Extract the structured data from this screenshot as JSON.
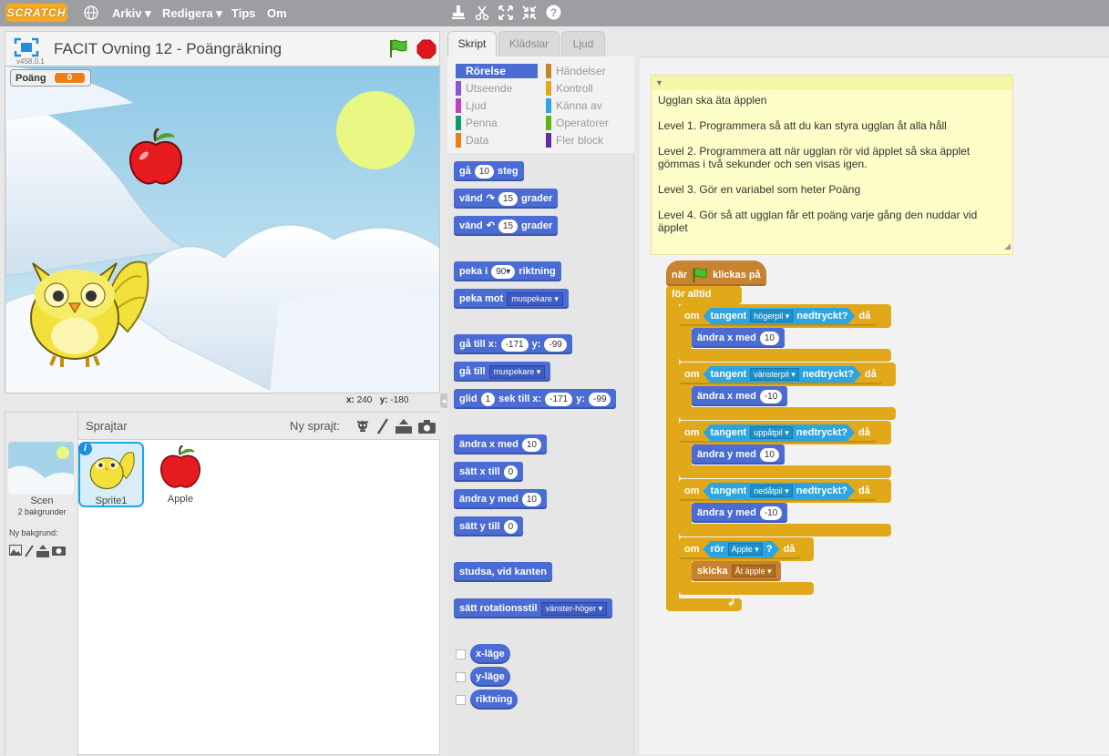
{
  "menubar": {
    "logo": "SCRATCH",
    "items": [
      "Arkiv ▾",
      "Redigera ▾",
      "Tips",
      "Om"
    ]
  },
  "project": {
    "title": "FACIT Ovning 12 - Poängräkning",
    "version": "v458.0.1"
  },
  "monitor": {
    "label": "Poäng",
    "value": "0"
  },
  "coords": {
    "x_label": "x:",
    "x": "240",
    "y_label": "y:",
    "y": "-180"
  },
  "sprites_panel": {
    "title": "Sprajtar",
    "new_sprite": "Ny sprajt:",
    "scene_label": "Scen",
    "scene_sub": "2 bakgrunder",
    "new_backdrop": "Ny bakgrund:",
    "sprites": [
      {
        "name": "Sprite1"
      },
      {
        "name": "Apple"
      }
    ]
  },
  "tabs": [
    "Skript",
    "Klädslar",
    "Ljud"
  ],
  "categories": [
    {
      "label": "Rörelse",
      "color": "#4a6cd4"
    },
    {
      "label": "Händelser",
      "color": "#c88330"
    },
    {
      "label": "Utseende",
      "color": "#8a55d7"
    },
    {
      "label": "Kontroll",
      "color": "#e1a91a"
    },
    {
      "label": "Ljud",
      "color": "#bb42c3"
    },
    {
      "label": "Känna av",
      "color": "#2ca5e2"
    },
    {
      "label": "Penna",
      "color": "#0e9a6c"
    },
    {
      "label": "Operatorer",
      "color": "#5cb712"
    },
    {
      "label": "Data",
      "color": "#ee7d16"
    },
    {
      "label": "Fler block",
      "color": "#632d99"
    }
  ],
  "palette": {
    "move_a": "gå",
    "move_n": "10",
    "move_b": "steg",
    "turn_a": "vänd",
    "turn_n": "15",
    "turn_b": "grader",
    "turn2_a": "vänd",
    "turn2_n": "15",
    "turn2_b": "grader",
    "point_a": "peka i",
    "point_n": "90▾",
    "point_b": "riktning",
    "toward_a": "peka mot",
    "toward_dd": "muspekare ▾",
    "goto_a": "gå till x:",
    "goto_x": "-171",
    "goto_b": "y:",
    "goto_y": "-99",
    "goto2_a": "gå till",
    "goto2_dd": "muspekare ▾",
    "glide_a": "glid",
    "glide_n": "1",
    "glide_b": "sek till x:",
    "glide_x": "-171",
    "glide_c": "y:",
    "glide_y": "-99",
    "chx_a": "ändra x med",
    "chx_n": "10",
    "setx_a": "sätt x till",
    "setx_n": "0",
    "chy_a": "ändra y med",
    "chy_n": "10",
    "sety_a": "sätt y till",
    "sety_n": "0",
    "bounce": "studsa, vid kanten",
    "rot_a": "sätt rotationsstil",
    "rot_dd": "vänster-höger ▾",
    "rep1": "x-läge",
    "rep2": "y-läge",
    "rep3": "riktning"
  },
  "note": {
    "lines": [
      "Ugglan ska äta äpplen",
      "Level 1. Programmera så att du kan styra ugglan åt alla håll",
      "Level 2. Programmera att när ugglan rör vid äpplet så ska äpplet gömmas i två sekunder och sen visas igen.",
      "Level 3. Gör en variabel som heter Poäng",
      "Level 4. Gör så att ugglan får ett poäng varje gång den nuddar vid äpplet"
    ]
  },
  "script": {
    "hat_a": "när",
    "hat_b": "klickas på",
    "forever": "för alltid",
    "if": "om",
    "then": "då",
    "key": "tangent",
    "pressed": "nedtryckt?",
    "k1": "högerpil ▾",
    "a1": "ändra x med",
    "v1": "10",
    "k2": "vänsterpil ▾",
    "a2": "ändra x med",
    "v2": "-10",
    "k3": "uppåtpil ▾",
    "a3": "ändra y med",
    "v3": "10",
    "k4": "nedåtpil ▾",
    "a4": "ändra y med",
    "v4": "-10",
    "touch": "rör",
    "touch_dd": "Apple ▾",
    "q": "?",
    "broadcast": "skicka",
    "broadcast_dd": "Åt äpple ▾"
  }
}
